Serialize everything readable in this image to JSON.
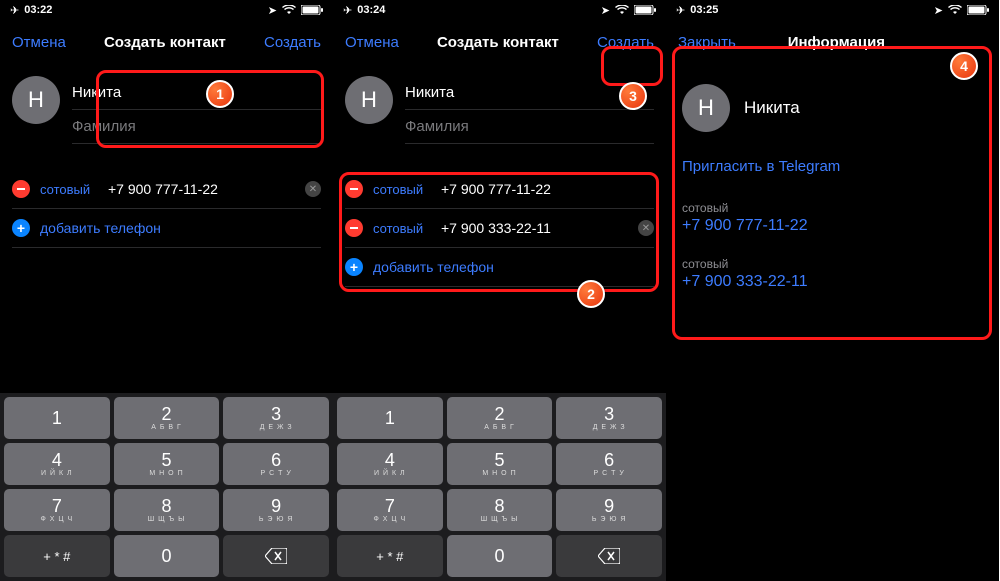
{
  "status": {
    "t1": "03:22",
    "t2": "03:24",
    "t3": "03:25"
  },
  "nav": {
    "cancel": "Отмена",
    "title": "Создать контакт",
    "create": "Создать",
    "close": "Закрыть",
    "info": "Информация"
  },
  "contact": {
    "first": "Никита",
    "last_ph": "Фамилия",
    "avatar_letter": "Н"
  },
  "phones": {
    "type": "сотовый",
    "n1": "+7 900 777-11-22",
    "n2": "+7 900 333-22-11",
    "add": "добавить телефон"
  },
  "info": {
    "invite": "Пригласить в Telegram",
    "label": "сотовый"
  },
  "keypad": {
    "r1": [
      {
        "m": "1"
      },
      {
        "m": "2",
        "s": "А Б В Г"
      },
      {
        "m": "3",
        "s": "Д Е Ж З"
      }
    ],
    "r2": [
      {
        "m": "4",
        "s": "И Й К Л"
      },
      {
        "m": "5",
        "s": "М Н О П"
      },
      {
        "m": "6",
        "s": "Р С Т У"
      }
    ],
    "r3": [
      {
        "m": "7",
        "s": "Ф Х Ц Ч"
      },
      {
        "m": "8",
        "s": "Ш Щ Ъ Ы"
      },
      {
        "m": "9",
        "s": "Ь Э Ю Я"
      }
    ],
    "r4_sym": "+ * #",
    "r4_zero": "0"
  },
  "badges": {
    "b1": "1",
    "b2": "2",
    "b3": "3",
    "b4": "4"
  }
}
